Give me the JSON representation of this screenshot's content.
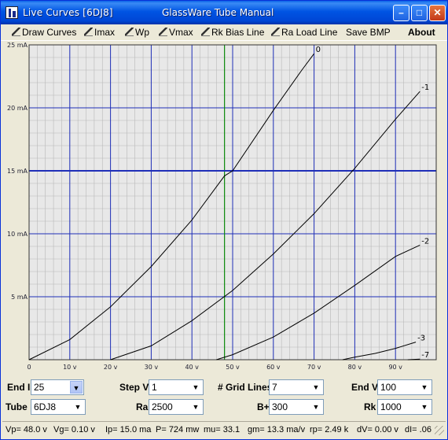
{
  "window": {
    "title": "Live Curves [6DJ8]",
    "subtitle": "GlassWare Tube Manual",
    "min_glyph": "–",
    "max_glyph": "□",
    "close_glyph": "✕"
  },
  "menu": [
    {
      "label": "Draw Curves",
      "icon": "pen-icon",
      "access": "D"
    },
    {
      "label": "Imax",
      "icon": "pen-icon",
      "access": "I"
    },
    {
      "label": "Wp",
      "icon": "pen-icon",
      "access": "W"
    },
    {
      "label": "Vmax",
      "icon": "pen-icon",
      "access": "V"
    },
    {
      "label": "Rk Bias Line",
      "icon": "pen-icon",
      "access": "R"
    },
    {
      "label": "Ra Load Line",
      "icon": "pen-icon",
      "access": "R"
    },
    {
      "label": "Save BMP",
      "icon": "",
      "access": "S"
    },
    {
      "label": "About",
      "icon": "",
      "access": ""
    }
  ],
  "chart_data": {
    "type": "line",
    "title": "",
    "xlabel": "",
    "ylabel": "",
    "xlim": [
      0,
      100
    ],
    "ylim": [
      0,
      25
    ],
    "x_ticks": [
      "0",
      "10 v",
      "20 v",
      "30 v",
      "40 v",
      "50 v",
      "60 v",
      "70 v",
      "80 v",
      "90 v"
    ],
    "y_ticks": [
      "5 mA",
      "10 mA",
      "15 mA",
      "20 mA",
      "25 mA"
    ],
    "grid": true,
    "colors": {
      "background": "#E8E8E8",
      "minor_grid": "#B8B8B8",
      "major_grid": "#1F2FB8",
      "curve": "#000000",
      "marker_v": "#0B8A0B",
      "marker_h": "#1F2FB8"
    },
    "marker": {
      "vp": 48.0,
      "ip": 15.0
    },
    "series": [
      {
        "name": "0",
        "x": [
          0,
          10,
          20,
          30,
          40,
          48,
          50,
          60,
          67,
          70
        ],
        "y": [
          0,
          1.6,
          4.2,
          7.4,
          11.1,
          14.6,
          15.0,
          19.8,
          23.0,
          24.3
        ]
      },
      {
        "name": "-1",
        "x": [
          20,
          30,
          40,
          50,
          60,
          70,
          80,
          90,
          96
        ],
        "y": [
          0,
          1.1,
          3.1,
          5.5,
          8.4,
          11.6,
          15.2,
          19.1,
          21.3
        ]
      },
      {
        "name": "-2",
        "x": [
          46,
          50,
          60,
          70,
          80,
          90,
          96
        ],
        "y": [
          0,
          0.4,
          1.8,
          3.7,
          5.9,
          8.2,
          9.1
        ]
      },
      {
        "name": "-3",
        "x": [
          77,
          80,
          85,
          90,
          95
        ],
        "y": [
          0,
          0.2,
          0.5,
          0.9,
          1.4
        ]
      },
      {
        "name": "-7",
        "x": [
          93,
          96
        ],
        "y": [
          0,
          0.05
        ]
      }
    ]
  },
  "controls": {
    "end_i": {
      "label": "End I",
      "value": "25"
    },
    "step_v": {
      "label": "Step V",
      "value": "1"
    },
    "grid_lines": {
      "label": "# Grid Lines",
      "value": "7"
    },
    "end_v": {
      "label": "End V",
      "value": "100"
    },
    "tube": {
      "label": "Tube",
      "value": "6DJ8"
    },
    "ra": {
      "label": "Ra",
      "value": "2500"
    },
    "b_plus": {
      "label": "B+",
      "value": "300"
    },
    "rk": {
      "label": "Rk",
      "value": "1000"
    }
  },
  "status": {
    "vp": "Vp= 48.0 v",
    "vg": "Vg=  0.10 v",
    "ip": "Ip= 15.0 ma",
    "p": "P= 724 mw",
    "mu": "mu=  33.1",
    "gm": "gm= 13.3 ma/v",
    "rp": "rp= 2.49 k",
    "dv": "dV=  0.00 v",
    "di": "dI= .06"
  }
}
